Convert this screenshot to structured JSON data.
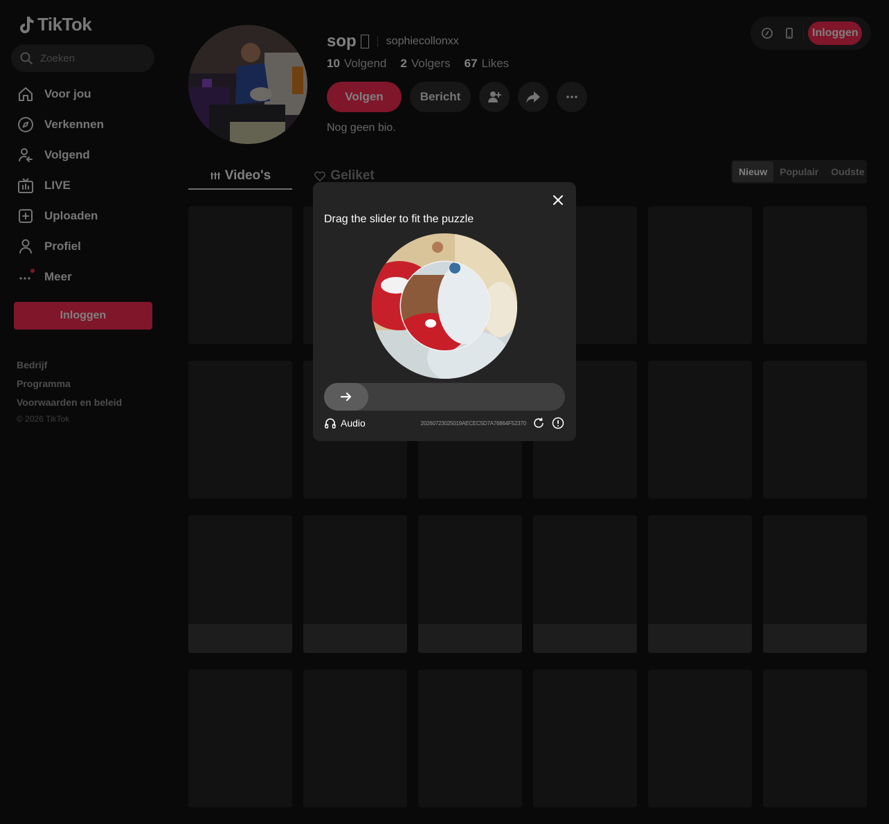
{
  "app": {
    "logo_text": "TikTok"
  },
  "search": {
    "placeholder": "Zoeken"
  },
  "sidebar": {
    "items": [
      {
        "label": "Voor jou",
        "icon": "home-icon"
      },
      {
        "label": "Verkennen",
        "icon": "compass-icon"
      },
      {
        "label": "Volgend",
        "icon": "following-icon"
      },
      {
        "label": "LIVE",
        "icon": "live-icon"
      },
      {
        "label": "Uploaden",
        "icon": "upload-icon"
      },
      {
        "label": "Profiel",
        "icon": "profile-icon"
      },
      {
        "label": "Meer",
        "icon": "more-icon"
      }
    ],
    "login_label": "Inloggen",
    "footer_links": [
      "Bedrijf",
      "Programma",
      "Voorwaarden en beleid"
    ],
    "copyright": "© 2026 TikTok"
  },
  "topbar": {
    "login_label": "Inloggen"
  },
  "profile": {
    "display_name": "sop",
    "handle": "sophiecollonxx",
    "stats": {
      "following_count": "10",
      "following_label": "Volgend",
      "followers_count": "2",
      "followers_label": "Volgers",
      "likes_count": "67",
      "likes_label": "Likes"
    },
    "follow_label": "Volgen",
    "message_label": "Bericht",
    "bio": "Nog geen bio."
  },
  "tabs": {
    "videos": "Video's",
    "liked": "Geliket"
  },
  "sort": {
    "options": [
      "Nieuw",
      "Populair",
      "Oudste"
    ],
    "active": "Nieuw"
  },
  "captcha": {
    "title": "Drag the slider to fit the puzzle",
    "audio_label": "Audio",
    "id": "2026072302501​9AECEC5D7A76864F52370",
    "slider_progress": 0
  },
  "colors": {
    "accent": "#fe2c55",
    "background": "#121212",
    "modal": "#242424"
  }
}
